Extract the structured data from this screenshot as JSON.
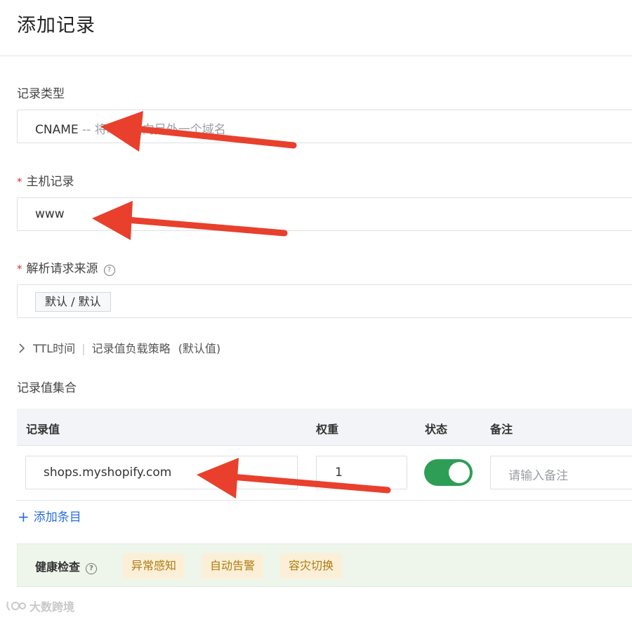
{
  "header": {
    "title": "添加记录"
  },
  "record_type": {
    "label": "记录类型",
    "value": "CNAME",
    "description": "-- 将域名指向另外一个域名"
  },
  "host_record": {
    "required_mark": "*",
    "label": "主机记录",
    "value": "www"
  },
  "resolve_source": {
    "required_mark": "*",
    "label": "解析请求来源",
    "help": "?",
    "tag": "默认 / 默认"
  },
  "advanced": {
    "chevron": "›",
    "ttl_label": "TTL时间",
    "separator": "|",
    "strategy_label": "记录值负载策略",
    "default_note": "(默认值)"
  },
  "records": {
    "section_title": "记录值集合",
    "columns": {
      "value": "记录值",
      "weight": "权重",
      "status": "状态",
      "note": "备注"
    },
    "rows": [
      {
        "value": "shops.myshopify.com",
        "weight": "1",
        "status_on": true,
        "note_placeholder": "请输入备注"
      }
    ],
    "add_label": "添加条目",
    "add_plus": "+"
  },
  "health": {
    "label": "健康检查",
    "help": "?",
    "chips": [
      "异常感知",
      "自动告警",
      "容灾切换"
    ]
  },
  "watermark": {
    "text": "大数跨境"
  },
  "colors": {
    "accent_blue": "#2a6ee0",
    "toggle_green": "#2e9e57",
    "required_red": "#e0312e",
    "annotation_arrow": "#e8402c",
    "health_bg": "#eef6ec",
    "chip_bg": "#fbf0d7"
  },
  "icons": {
    "help": "help-circle-icon",
    "chevron": "chevron-right-icon",
    "plus": "plus-icon"
  }
}
